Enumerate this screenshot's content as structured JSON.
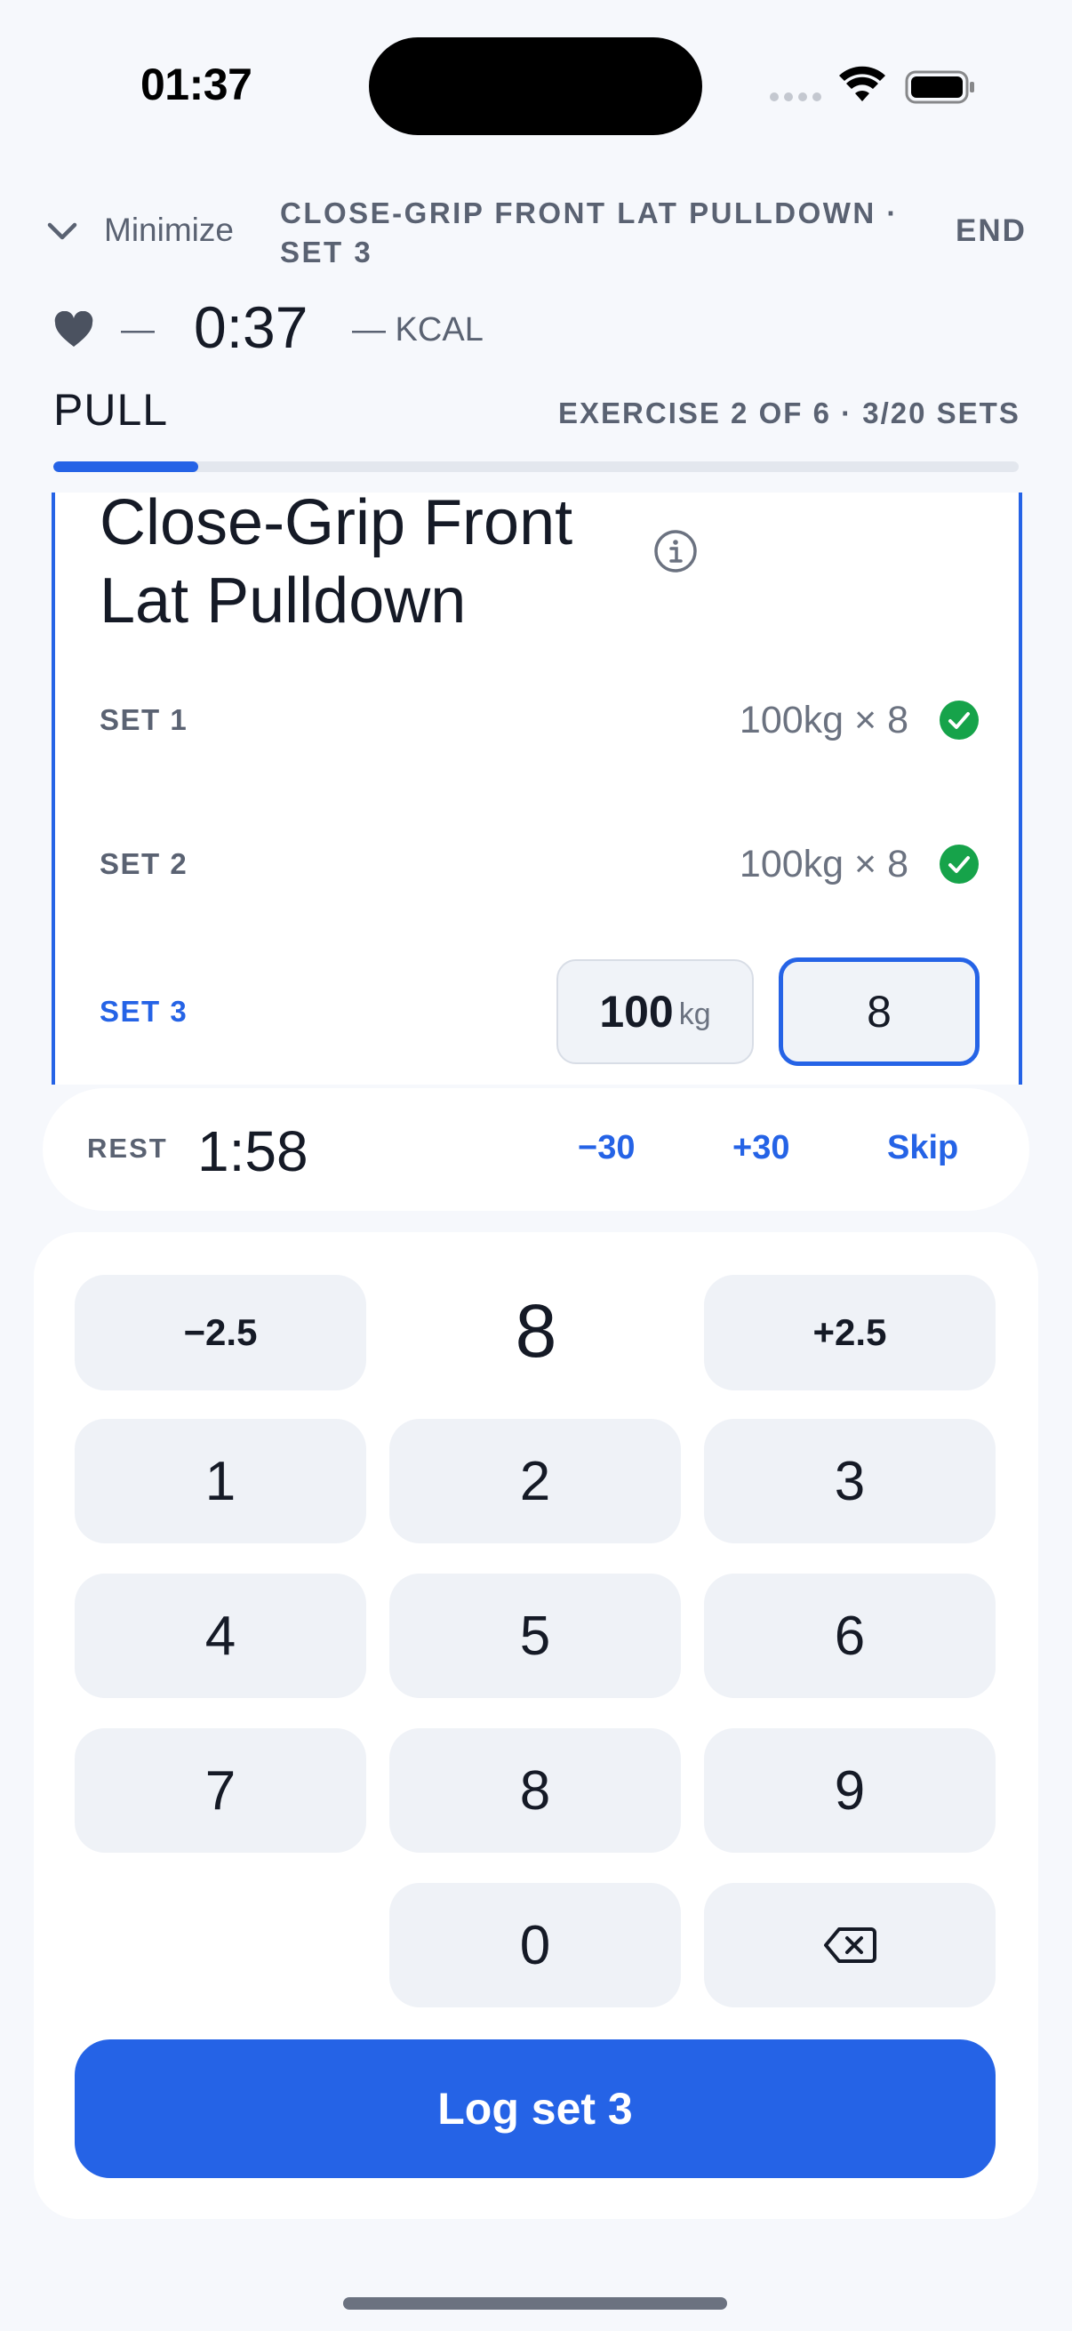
{
  "status_bar": {
    "time": "01:37"
  },
  "header": {
    "minimize_label": "Minimize",
    "exercise_set_title": "CLOSE-GRIP FRONT LAT PULLDOWN · SET 3",
    "end_label": "END"
  },
  "stats": {
    "heart_rate": "—",
    "elapsed_time": "0:37",
    "calories": "— KCAL"
  },
  "workout": {
    "name": "PULL",
    "progress_text": "EXERCISE 2 OF 6 · 3/20 SETS",
    "progress_fraction": 0.15
  },
  "exercise_card": {
    "name": "Close-Grip Front Lat Pulldown",
    "sets": [
      {
        "label": "SET 1",
        "value": "100kg × 8",
        "completed": true
      },
      {
        "label": "SET 2",
        "value": "100kg × 8",
        "completed": true
      }
    ],
    "current_set": {
      "label": "SET 3",
      "weight": "100",
      "weight_unit": "kg",
      "reps": "8"
    }
  },
  "rest": {
    "label": "REST",
    "time": "1:58",
    "minus_label": "−30",
    "plus_label": "+30",
    "skip_label": "Skip"
  },
  "keypad": {
    "decrement_label": "−2.5",
    "increment_label": "+2.5",
    "display_value": "8",
    "digits": [
      "1",
      "2",
      "3",
      "4",
      "5",
      "6",
      "7",
      "8",
      "9",
      "0"
    ],
    "backspace_icon": "backspace-icon"
  },
  "log_button_label": "Log set 3",
  "colors": {
    "accent": "#2563e6",
    "success": "#16a34a",
    "background": "#f6f8fc"
  }
}
